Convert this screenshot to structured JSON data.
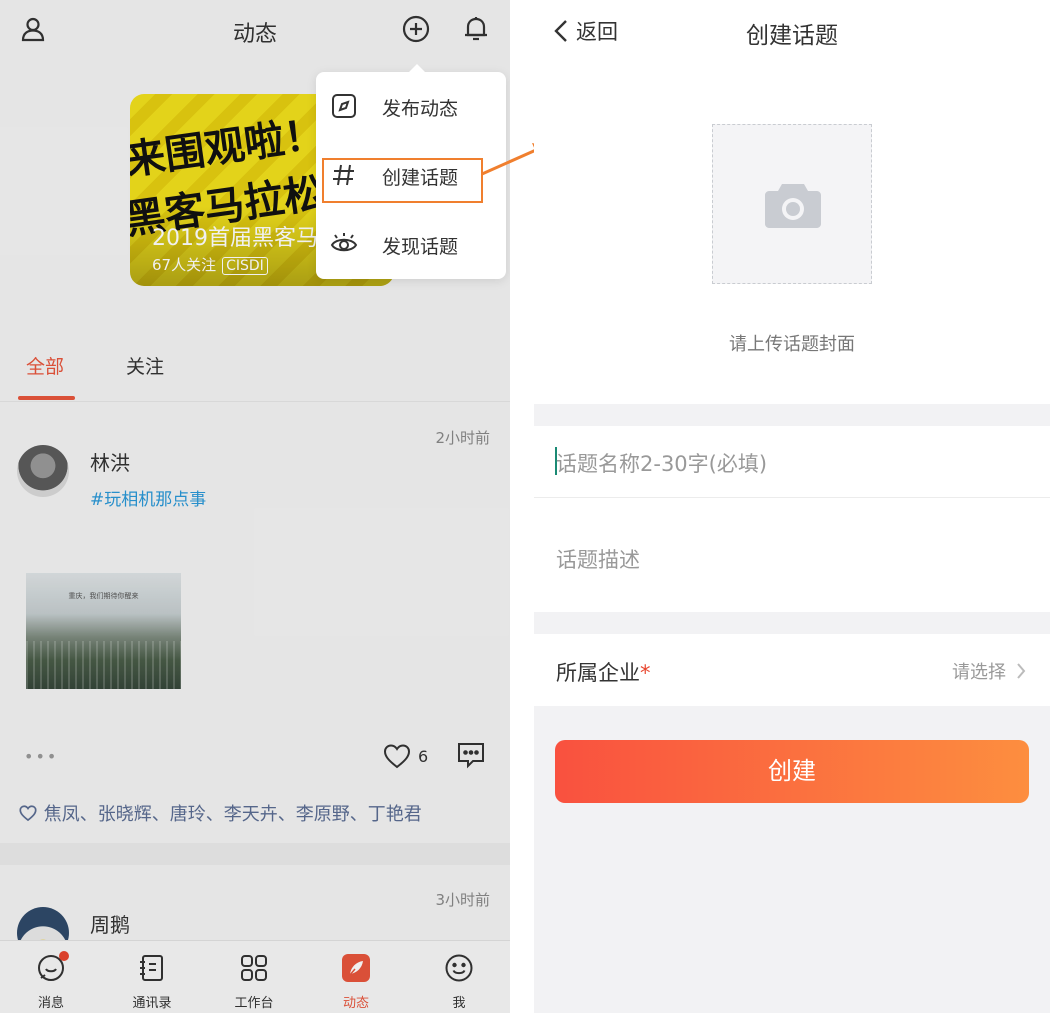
{
  "left": {
    "header": {
      "title": "动态"
    },
    "banner": {
      "scrawl_line1": "来围观啦！！",
      "scrawl_line2": "黑客马拉松",
      "title": "2019首届黑客马",
      "followers": "67人关注",
      "tag": "CISDI"
    },
    "tabs": [
      {
        "label": "全部"
      },
      {
        "label": "关注"
      }
    ],
    "posts": [
      {
        "author": "林洪",
        "topic": "#玩相机那点事",
        "time": "2小时前",
        "photo_caption": "重庆，我们期待你醒来",
        "more": "•••",
        "likes": "6",
        "likers": "焦凤、张晓辉、唐玲、李天卉、李原野、丁艳君"
      },
      {
        "author": "周鹅",
        "time": "3小时前"
      }
    ],
    "bottom_nav": [
      {
        "label": "消息",
        "icon": "message-icon"
      },
      {
        "label": "通讯录",
        "icon": "contacts-icon"
      },
      {
        "label": "工作台",
        "icon": "workbench-icon"
      },
      {
        "label": "动态",
        "icon": "feed-icon"
      },
      {
        "label": "我",
        "icon": "me-icon"
      }
    ],
    "popup_menu": [
      {
        "label": "发布动态",
        "icon": "compass-icon"
      },
      {
        "label": "创建话题",
        "icon": "hash-icon"
      },
      {
        "label": "发现话题",
        "icon": "eye-icon"
      }
    ]
  },
  "right": {
    "back_label": "返回",
    "title": "创建话题",
    "upload_hint": "请上传话题封面",
    "name_placeholder": "话题名称2-30字(必填)",
    "desc_placeholder": "话题描述",
    "company_label": "所属企业",
    "required_mark": "*",
    "company_select": "请选择",
    "create_button": "创建"
  },
  "colors": {
    "accent": "#e8553c",
    "link": "#2a98d8",
    "highlight": "#f07f2e",
    "button_start": "#f9513f",
    "button_end": "#fd8e3f"
  }
}
